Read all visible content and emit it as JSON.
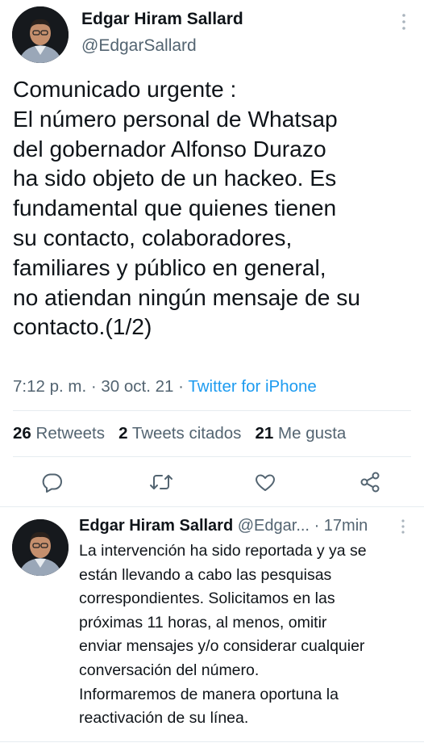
{
  "tweet": {
    "author_name": "Edgar Hiram Sallard",
    "author_handle": "@EdgarSallard",
    "text_lines": [
      "Comunicado urgente :",
      "El número personal de Whatsap",
      "del gobernador Alfonso Durazo",
      "ha sido objeto de un hackeo. Es",
      "fundamental que quienes tienen",
      "su contacto, colaboradores,",
      "familiares y público en general,",
      "no atiendan ningún mensaje de su",
      "contacto.(1/2)"
    ],
    "time": "7:12 p. m.",
    "date": "30 oct. 21",
    "source": "Twitter for iPhone",
    "retweets_count": "26",
    "retweets_label": "Retweets",
    "quotes_count": "2",
    "quotes_label": "Tweets citados",
    "likes_count": "21",
    "likes_label": "Me gusta"
  },
  "reply": {
    "author_name": "Edgar Hiram Sallard",
    "author_handle_trunc": "@Edgar...",
    "age": "17min",
    "text_lines": [
      "La intervención ha sido reportada y ya se",
      "están llevando a cabo las pesquisas",
      "correspondientes. Solicitamos en las",
      "próximas 11 horas, al menos, omitir",
      "enviar mensajes y/o considerar cualquier",
      "conversación del número.",
      "Informaremos de manera oportuna la",
      "reactivación de su línea."
    ]
  },
  "icons": {
    "reply": "comment-icon",
    "retweet": "retweet-icon",
    "like": "heart-icon",
    "share": "share-icon",
    "more": "more-vertical-icon"
  },
  "colors": {
    "text": "#0f1419",
    "secondary": "#536471",
    "link": "#1d9bf0",
    "divider": "#e6ecf0"
  }
}
